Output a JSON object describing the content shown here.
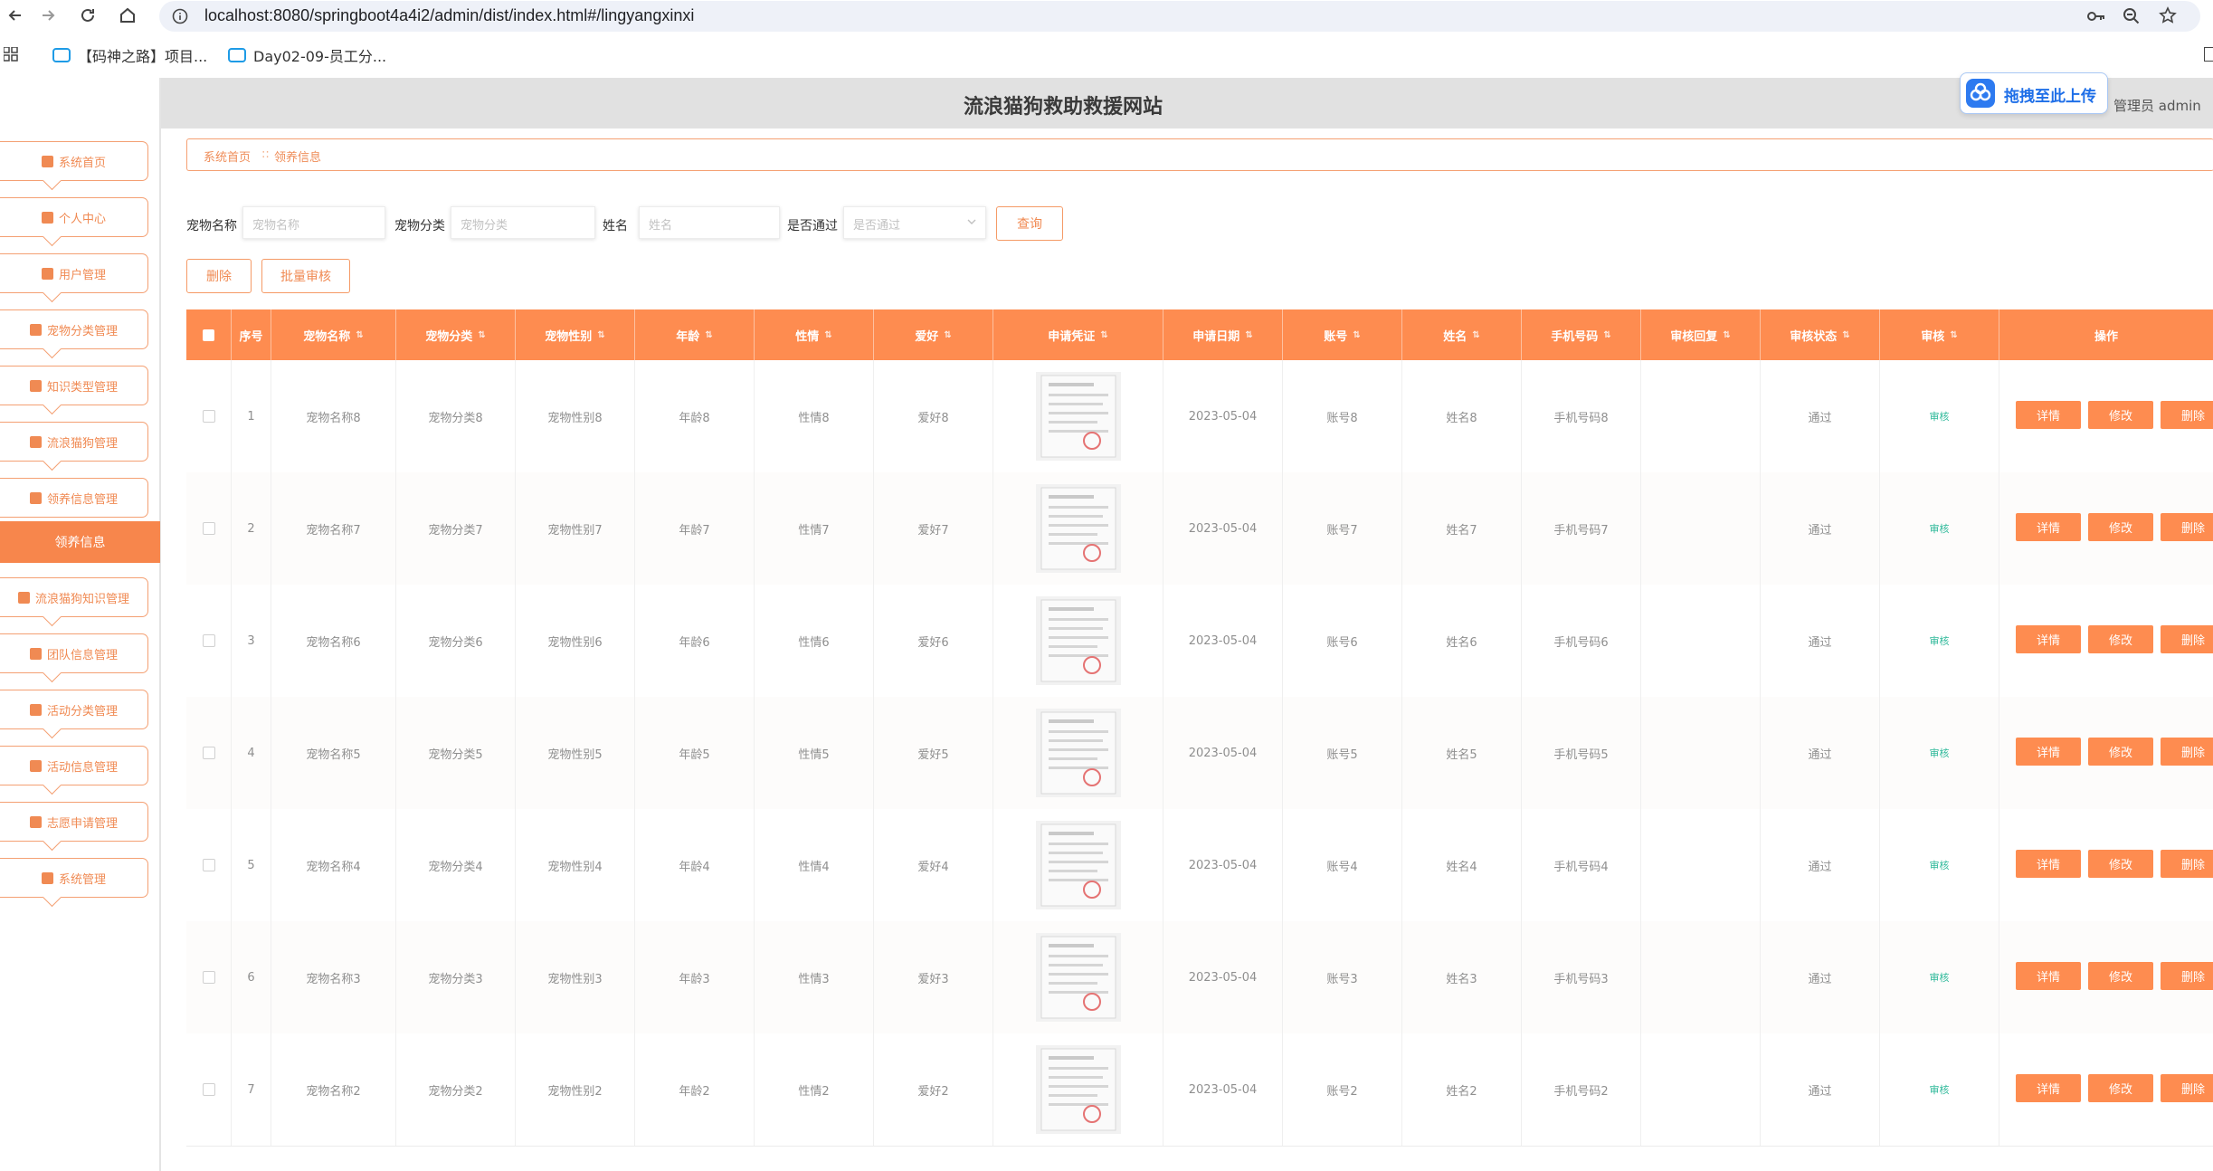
{
  "browser": {
    "url": "localhost:8080/springboot4a4i2/admin/dist/index.html#/lingyangxinxi",
    "bookmarks": [
      "【码神之路】项目...",
      "Day02-09-员工分..."
    ]
  },
  "header": {
    "site_title": "流浪猫狗救助救援网站",
    "upload_label": "拖拽至此上传",
    "user_label": "管理员 admin"
  },
  "sidebar": {
    "items": [
      {
        "label": "系统首页",
        "icon": "home-icon"
      },
      {
        "label": "个人中心",
        "icon": "user-icon"
      },
      {
        "label": "用户管理",
        "icon": "list-icon"
      },
      {
        "label": "宠物分类管理",
        "icon": "grid-icon"
      },
      {
        "label": "知识类型管理",
        "icon": "book-icon"
      },
      {
        "label": "流浪猫狗管理",
        "icon": "monitor-icon"
      },
      {
        "label": "领养信息管理",
        "icon": "briefcase-icon"
      },
      {
        "label": "流浪猫狗知识管理",
        "icon": "grid-icon"
      },
      {
        "label": "团队信息管理",
        "icon": "grid-icon"
      },
      {
        "label": "活动分类管理",
        "icon": "grid-icon"
      },
      {
        "label": "活动信息管理",
        "icon": "grid-icon"
      },
      {
        "label": "志愿申请管理",
        "icon": "grid-icon"
      },
      {
        "label": "系统管理",
        "icon": "monitor-icon"
      }
    ],
    "active_sub": "领养信息"
  },
  "breadcrumb": {
    "home": "系统首页",
    "separator": "::",
    "current": "领养信息"
  },
  "search": {
    "pet_name_label": "宠物名称",
    "pet_name_placeholder": "宠物名称",
    "pet_category_label": "宠物分类",
    "pet_category_placeholder": "宠物分类",
    "name_label": "姓名",
    "name_placeholder": "姓名",
    "passed_label": "是否通过",
    "passed_placeholder": "是否通过",
    "query_button": "查询"
  },
  "actions": {
    "delete": "删除",
    "batch_audit": "批量审核"
  },
  "table": {
    "columns": [
      "序号",
      "宠物名称",
      "宠物分类",
      "宠物性别",
      "年龄",
      "性情",
      "爱好",
      "申请凭证",
      "申请日期",
      "账号",
      "姓名",
      "手机号码",
      "审核回复",
      "审核状态",
      "审核",
      "操作"
    ],
    "row_buttons": {
      "detail": "详情",
      "edit": "修改",
      "delete": "删除"
    },
    "rows": [
      {
        "no": "1",
        "pet_name": "宠物名称8",
        "category": "宠物分类8",
        "gender": "宠物性别8",
        "age": "年龄8",
        "temper": "性情8",
        "hobby": "爱好8",
        "date": "2023-05-04",
        "account": "账号8",
        "name": "姓名8",
        "phone": "手机号码8",
        "reply": "",
        "status": "通过",
        "audit": "审核"
      },
      {
        "no": "2",
        "pet_name": "宠物名称7",
        "category": "宠物分类7",
        "gender": "宠物性别7",
        "age": "年龄7",
        "temper": "性情7",
        "hobby": "爱好7",
        "date": "2023-05-04",
        "account": "账号7",
        "name": "姓名7",
        "phone": "手机号码7",
        "reply": "",
        "status": "通过",
        "audit": "审核"
      },
      {
        "no": "3",
        "pet_name": "宠物名称6",
        "category": "宠物分类6",
        "gender": "宠物性别6",
        "age": "年龄6",
        "temper": "性情6",
        "hobby": "爱好6",
        "date": "2023-05-04",
        "account": "账号6",
        "name": "姓名6",
        "phone": "手机号码6",
        "reply": "",
        "status": "通过",
        "audit": "审核"
      },
      {
        "no": "4",
        "pet_name": "宠物名称5",
        "category": "宠物分类5",
        "gender": "宠物性别5",
        "age": "年龄5",
        "temper": "性情5",
        "hobby": "爱好5",
        "date": "2023-05-04",
        "account": "账号5",
        "name": "姓名5",
        "phone": "手机号码5",
        "reply": "",
        "status": "通过",
        "audit": "审核"
      },
      {
        "no": "5",
        "pet_name": "宠物名称4",
        "category": "宠物分类4",
        "gender": "宠物性别4",
        "age": "年龄4",
        "temper": "性情4",
        "hobby": "爱好4",
        "date": "2023-05-04",
        "account": "账号4",
        "name": "姓名4",
        "phone": "手机号码4",
        "reply": "",
        "status": "通过",
        "audit": "审核"
      },
      {
        "no": "6",
        "pet_name": "宠物名称3",
        "category": "宠物分类3",
        "gender": "宠物性别3",
        "age": "年龄3",
        "temper": "性情3",
        "hobby": "爱好3",
        "date": "2023-05-04",
        "account": "账号3",
        "name": "姓名3",
        "phone": "手机号码3",
        "reply": "",
        "status": "通过",
        "audit": "审核"
      },
      {
        "no": "7",
        "pet_name": "宠物名称2",
        "category": "宠物分类2",
        "gender": "宠物性别2",
        "age": "年龄2",
        "temper": "性情2",
        "hobby": "爱好2",
        "date": "2023-05-04",
        "account": "账号2",
        "name": "姓名2",
        "phone": "手机号码2",
        "reply": "",
        "status": "通过",
        "audit": "审核"
      }
    ]
  },
  "colors": {
    "accent": "#fe8c50",
    "audit_text": "#2fb99a",
    "header_bg": "#e1e1e1"
  }
}
